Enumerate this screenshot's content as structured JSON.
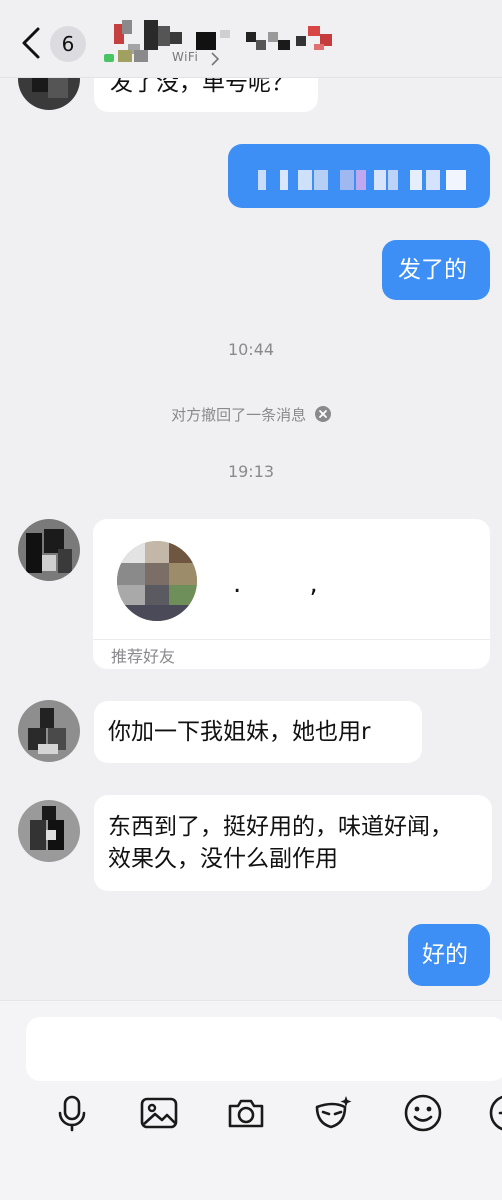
{
  "header": {
    "unread_count": "6",
    "contact_status": "WiFi"
  },
  "messages": {
    "in_1_text": "发了没，单号呢？",
    "out_1_text": "发了的",
    "time_1": "10:44",
    "recall_notice": "对方撤回了一条消息",
    "time_2": "19:13",
    "card_footer": "推荐好友",
    "card_name": ". ,",
    "in_2_text": "你加一下我姐妹，她也用r",
    "in_3_line1": "东西到了，挺好用的，味道好闻，",
    "in_3_line2": "效果久，没什么副作用",
    "out_2_text": "好的"
  },
  "input": {
    "placeholder": ""
  },
  "toolbar": {
    "icons": [
      "microphone-icon",
      "image-icon",
      "camera-icon",
      "mask-sparkle-icon",
      "smiley-icon",
      "plus-icon"
    ]
  },
  "colors": {
    "background": "#f0f0f2",
    "outgoing_bubble": "#3e8ff5",
    "incoming_bubble": "#ffffff",
    "meta_text": "#8a8a8e"
  }
}
